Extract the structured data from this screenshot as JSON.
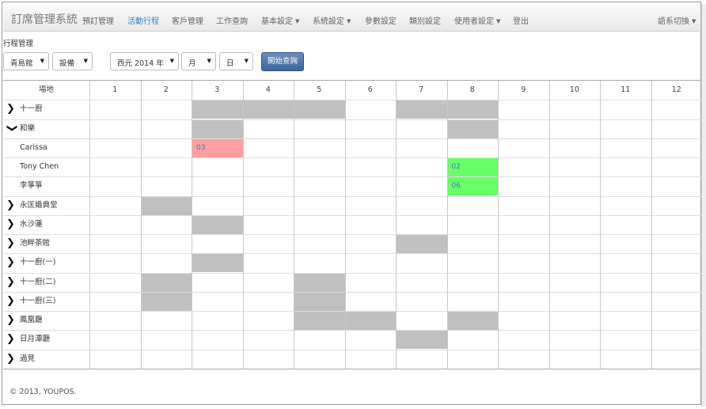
{
  "navbar": {
    "brand": "訂席管理系統",
    "items": [
      {
        "label": "預訂管理",
        "active": false,
        "dropdown": false
      },
      {
        "label": "活動行程",
        "active": true,
        "dropdown": false
      },
      {
        "label": "客戶管理",
        "active": false,
        "dropdown": false
      },
      {
        "label": "工作查詢",
        "active": false,
        "dropdown": false
      },
      {
        "label": "基本設定",
        "active": false,
        "dropdown": true
      },
      {
        "label": "系統設定",
        "active": false,
        "dropdown": true
      },
      {
        "label": "參數設定",
        "active": false,
        "dropdown": false
      },
      {
        "label": "類別設定",
        "active": false,
        "dropdown": false
      },
      {
        "label": "使用者設定",
        "active": false,
        "dropdown": true
      },
      {
        "label": "登出",
        "active": false,
        "dropdown": false
      }
    ],
    "language": "語系切換"
  },
  "page_title": "行程管理",
  "filters": {
    "venue": "青島館",
    "type": "設備",
    "year": "西元 2014 年",
    "month": "月",
    "day": "日",
    "query_button": "開始查詢"
  },
  "schedule": {
    "first_col_header": "場地",
    "columns": [
      "1",
      "2",
      "3",
      "4",
      "5",
      "6",
      "7",
      "8",
      "9",
      "10",
      "11",
      "12"
    ],
    "rows": [
      {
        "label": "十一廚",
        "chevron": "right",
        "indent": false,
        "cells": [
          {
            "col": 3,
            "text": "",
            "status": "busy"
          },
          {
            "col": 4,
            "text": "",
            "status": "busy"
          },
          {
            "col": 5,
            "text": "",
            "status": "busy"
          },
          {
            "col": 7,
            "text": "",
            "status": "busy"
          },
          {
            "col": 8,
            "text": "",
            "status": "busy"
          }
        ]
      },
      {
        "label": "和樂",
        "chevron": "down",
        "indent": false,
        "cells": [
          {
            "col": 3,
            "text": "",
            "status": "busy"
          },
          {
            "col": 8,
            "text": "",
            "status": "busy"
          }
        ]
      },
      {
        "label": "Carissa",
        "chevron": "",
        "indent": true,
        "cells": [
          {
            "col": 3,
            "text": "03",
            "status": "pending"
          }
        ]
      },
      {
        "label": "Tony Chen",
        "chevron": "",
        "indent": true,
        "cells": [
          {
            "col": 8,
            "text": "02",
            "status": "confirmed"
          }
        ]
      },
      {
        "label": "李箏箏",
        "chevron": "",
        "indent": true,
        "cells": [
          {
            "col": 8,
            "text": "06",
            "status": "confirmed"
          }
        ]
      },
      {
        "label": "永匡婚典堂",
        "chevron": "right",
        "indent": false,
        "cells": [
          {
            "col": 2,
            "text": "",
            "status": "busy"
          }
        ]
      },
      {
        "label": "水沙蓮",
        "chevron": "right",
        "indent": false,
        "cells": [
          {
            "col": 3,
            "text": "",
            "status": "busy"
          }
        ]
      },
      {
        "label": "池畔茶館",
        "chevron": "right",
        "indent": false,
        "cells": [
          {
            "col": 7,
            "text": "",
            "status": "busy"
          }
        ]
      },
      {
        "label": "十一廚(一)",
        "chevron": "right",
        "indent": false,
        "cells": [
          {
            "col": 3,
            "text": "",
            "status": "busy"
          }
        ]
      },
      {
        "label": "十一廚(二)",
        "chevron": "right",
        "indent": false,
        "cells": [
          {
            "col": 2,
            "text": "",
            "status": "busy"
          },
          {
            "col": 5,
            "text": "",
            "status": "busy"
          }
        ]
      },
      {
        "label": "十一廚(三)",
        "chevron": "right",
        "indent": false,
        "cells": [
          {
            "col": 2,
            "text": "",
            "status": "busy"
          },
          {
            "col": 5,
            "text": "",
            "status": "busy"
          }
        ]
      },
      {
        "label": "鳳凰廳",
        "chevron": "right",
        "indent": false,
        "cells": [
          {
            "col": 5,
            "text": "",
            "status": "busy"
          },
          {
            "col": 6,
            "text": "",
            "status": "busy"
          },
          {
            "col": 8,
            "text": "",
            "status": "busy"
          }
        ]
      },
      {
        "label": "日月潭廳",
        "chevron": "right",
        "indent": false,
        "cells": [
          {
            "col": 7,
            "text": "",
            "status": "busy"
          }
        ]
      },
      {
        "label": "過見",
        "chevron": "right",
        "indent": false,
        "cells": []
      }
    ]
  },
  "colors": {
    "busy": "#c0c0c0",
    "pending": "#ff9e9e",
    "confirmed": "#66ff66",
    "active_link": "#3a87c8",
    "block_text": "#4a77c4"
  },
  "icons": {
    "chevron_right": "chevron-right-icon",
    "chevron_down": "chevron-down-icon",
    "caret": "caret-down-icon"
  },
  "footer": "© 2013, YOUPOS."
}
